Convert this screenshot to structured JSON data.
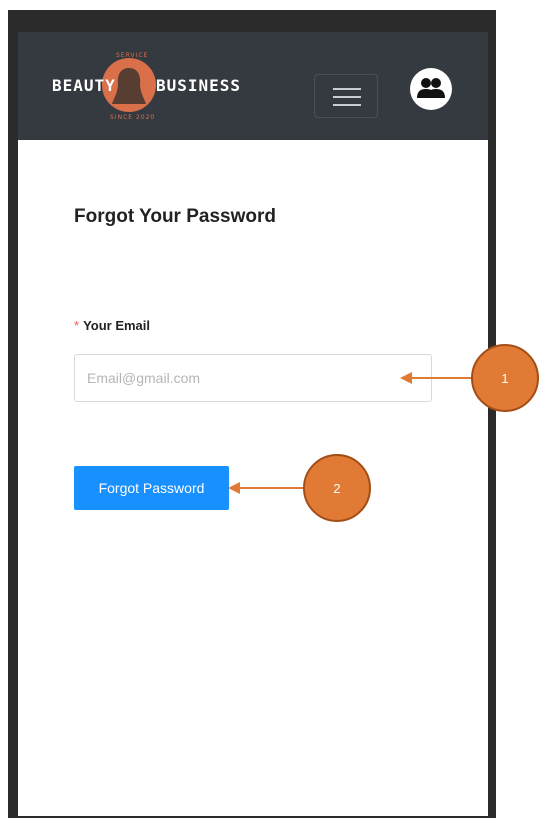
{
  "header": {
    "logo": {
      "word_left": "BEAUTY",
      "word_right": "BUSINESS",
      "small_top": "SERVICE",
      "small_bottom": "SINCE 2020"
    },
    "menu_icon": "hamburger-icon",
    "user_icon": "users-icon"
  },
  "form": {
    "title": "Forgot Your Password",
    "email_label": "Your Email",
    "required_mark": "*",
    "email_placeholder": "Email@gmail.com",
    "email_value": "",
    "submit_label": "Forgot Password"
  },
  "annotations": [
    {
      "number": "1",
      "points_to": "email-input"
    },
    {
      "number": "2",
      "points_to": "forgot-password-button"
    }
  ],
  "colors": {
    "navbar": "#343a40",
    "primary_button": "#1890ff",
    "callout": "#e07a35",
    "required": "#ff4d4f",
    "logo_accent": "#d9704a"
  }
}
